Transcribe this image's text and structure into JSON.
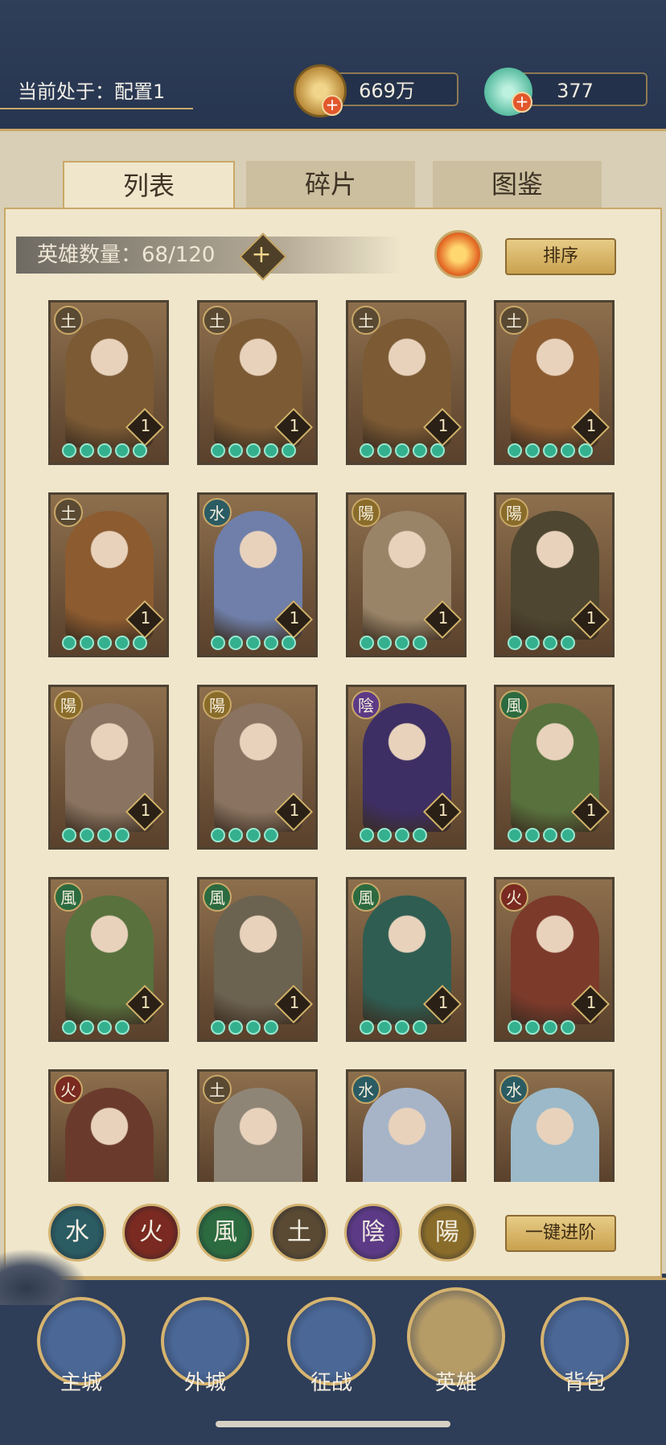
{
  "header": {
    "config_text": "当前处于：配置1",
    "gold_value": "669万",
    "jade_value": "377"
  },
  "tabs": [
    {
      "label": "列表",
      "active": true
    },
    {
      "label": "碎片",
      "active": false
    },
    {
      "label": "图鉴",
      "active": false
    }
  ],
  "list": {
    "hero_count_text": "英雄数量：68/120",
    "sort_label": "排序",
    "one_click_label": "一键进阶"
  },
  "heroes": [
    {
      "element": "土",
      "level": "1",
      "stars": 5,
      "color": "#7b5a34"
    },
    {
      "element": "土",
      "level": "1",
      "stars": 5,
      "color": "#7b5a34"
    },
    {
      "element": "土",
      "level": "1",
      "stars": 5,
      "color": "#7b5a34"
    },
    {
      "element": "土",
      "level": "1",
      "stars": 5,
      "color": "#8c5b30"
    },
    {
      "element": "土",
      "level": "1",
      "stars": 5,
      "color": "#8c5b30"
    },
    {
      "element": "水",
      "level": "1",
      "stars": 5,
      "color": "#6f7fa9"
    },
    {
      "element": "陽",
      "level": "1",
      "stars": 4,
      "color": "#9a8468"
    },
    {
      "element": "陽",
      "level": "1",
      "stars": 4,
      "color": "#4e4630"
    },
    {
      "element": "陽",
      "level": "1",
      "stars": 4,
      "color": "#8a7360"
    },
    {
      "element": "陽",
      "level": "1",
      "stars": 4,
      "color": "#8a7360"
    },
    {
      "element": "陰",
      "level": "1",
      "stars": 4,
      "color": "#3d2f63"
    },
    {
      "element": "風",
      "level": "1",
      "stars": 4,
      "color": "#58713d"
    },
    {
      "element": "風",
      "level": "1",
      "stars": 4,
      "color": "#58713d"
    },
    {
      "element": "風",
      "level": "1",
      "stars": 4,
      "color": "#6c6250"
    },
    {
      "element": "風",
      "level": "1",
      "stars": 4,
      "color": "#2f5d52"
    },
    {
      "element": "火",
      "level": "1",
      "stars": 4,
      "color": "#7c3a2b"
    },
    {
      "element": "火",
      "level": "",
      "stars": 0,
      "color": "#6a3b2c"
    },
    {
      "element": "土",
      "level": "",
      "stars": 0,
      "color": "#8f8576"
    },
    {
      "element": "水",
      "level": "",
      "stars": 0,
      "color": "#a7b4c8"
    },
    {
      "element": "水",
      "level": "",
      "stars": 0,
      "color": "#9bb9c8"
    }
  ],
  "filters": [
    {
      "label": "水",
      "color": "#2b5c63"
    },
    {
      "label": "火",
      "color": "#7a2a20"
    },
    {
      "label": "風",
      "color": "#2c6b3f"
    },
    {
      "label": "土",
      "color": "#5a4a33"
    },
    {
      "label": "陰",
      "color": "#5d3a86"
    },
    {
      "label": "陽",
      "color": "#8a6c2a"
    }
  ],
  "nav": [
    {
      "label": "主城"
    },
    {
      "label": "外城"
    },
    {
      "label": "征战"
    },
    {
      "label": "英雄"
    },
    {
      "label": "背包"
    }
  ]
}
